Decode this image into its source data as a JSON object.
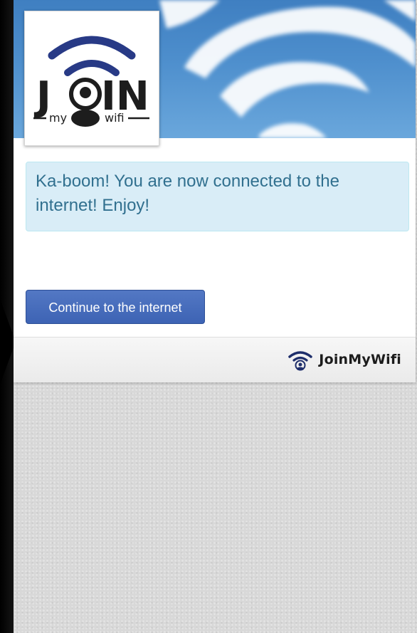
{
  "logo": {
    "word": "JOIN",
    "left_tag": "my",
    "right_tag": "wifi"
  },
  "alert": {
    "message": "Ka-boom! You are now connected to the internet! Enjoy!"
  },
  "continue_button": {
    "label": "Continue to the internet"
  },
  "footer": {
    "brand_name": "JoinMyWifi"
  },
  "icons": [
    "wifi-icon",
    "user-icon"
  ],
  "colors": {
    "brand_navy": "#1d2f6f",
    "button_blue": "#4a6fbf",
    "alert_bg": "#d9edf7",
    "alert_text": "#31708f"
  }
}
